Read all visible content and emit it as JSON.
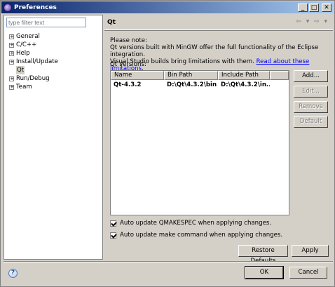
{
  "window": {
    "title": "Preferences",
    "controls": {
      "minimize": "_",
      "maximize": "□",
      "close": "✕"
    }
  },
  "left": {
    "filter_placeholder": "type filter text",
    "tree": [
      {
        "label": "General",
        "expander": "+"
      },
      {
        "label": "C/C++",
        "expander": "+"
      },
      {
        "label": "Help",
        "expander": "+"
      },
      {
        "label": "Install/Update",
        "expander": "+"
      },
      {
        "label": "Qt",
        "expander": ""
      },
      {
        "label": "Run/Debug",
        "expander": "+"
      },
      {
        "label": "Team",
        "expander": "+"
      }
    ]
  },
  "right": {
    "title": "Qt",
    "nav": "⇦ ▾ ⇨ ▾",
    "note_line1": "Please note:",
    "note_line2": "Qt versions built with MinGW offer the full functionality of the Eclipse integration.",
    "note_line3": "Visual Studio builds bring limitations with them.",
    "note_link": "Read about these limitations",
    "note_link_suffix": ".",
    "versions_label": "Qt Versions:",
    "table": {
      "headers": [
        "Name",
        "Bin Path",
        "Include Path"
      ],
      "rows": [
        {
          "name": "Qt-4.3.2",
          "bin": "D:\\Qt\\4.3.2\\bin",
          "include": "D:\\Qt\\4.3.2\\in..."
        }
      ]
    },
    "buttons": {
      "add": "Add...",
      "edit": "Edit...",
      "remove": "Remove",
      "default": "Default"
    },
    "checkboxes": {
      "qmakespec": "Auto update QMAKESPEC when applying changes.",
      "make": "Auto update make command when applying changes."
    },
    "restore_defaults": "Restore Defaults",
    "apply": "Apply"
  },
  "footer": {
    "help": "?",
    "ok": "OK",
    "cancel": "Cancel"
  }
}
